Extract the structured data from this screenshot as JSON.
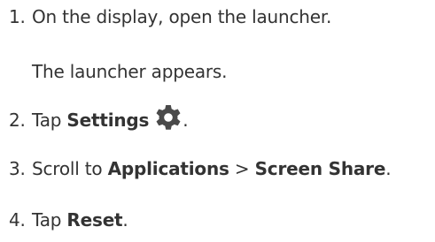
{
  "steps": [
    {
      "number": "1.",
      "text": "On the display, open the launcher.",
      "result": "The launcher appears."
    },
    {
      "number": "2.",
      "prefix": "Tap ",
      "bold": "Settings",
      "suffix": ".",
      "icon": "gear-icon",
      "icon_color": "#4a4a4a"
    },
    {
      "number": "3.",
      "prefix": "Scroll to ",
      "bold1": "Applications",
      "separator": " > ",
      "bold2": "Screen Share",
      "suffix": "."
    },
    {
      "number": "4.",
      "prefix": "Tap ",
      "bold": "Reset",
      "suffix": "."
    }
  ]
}
